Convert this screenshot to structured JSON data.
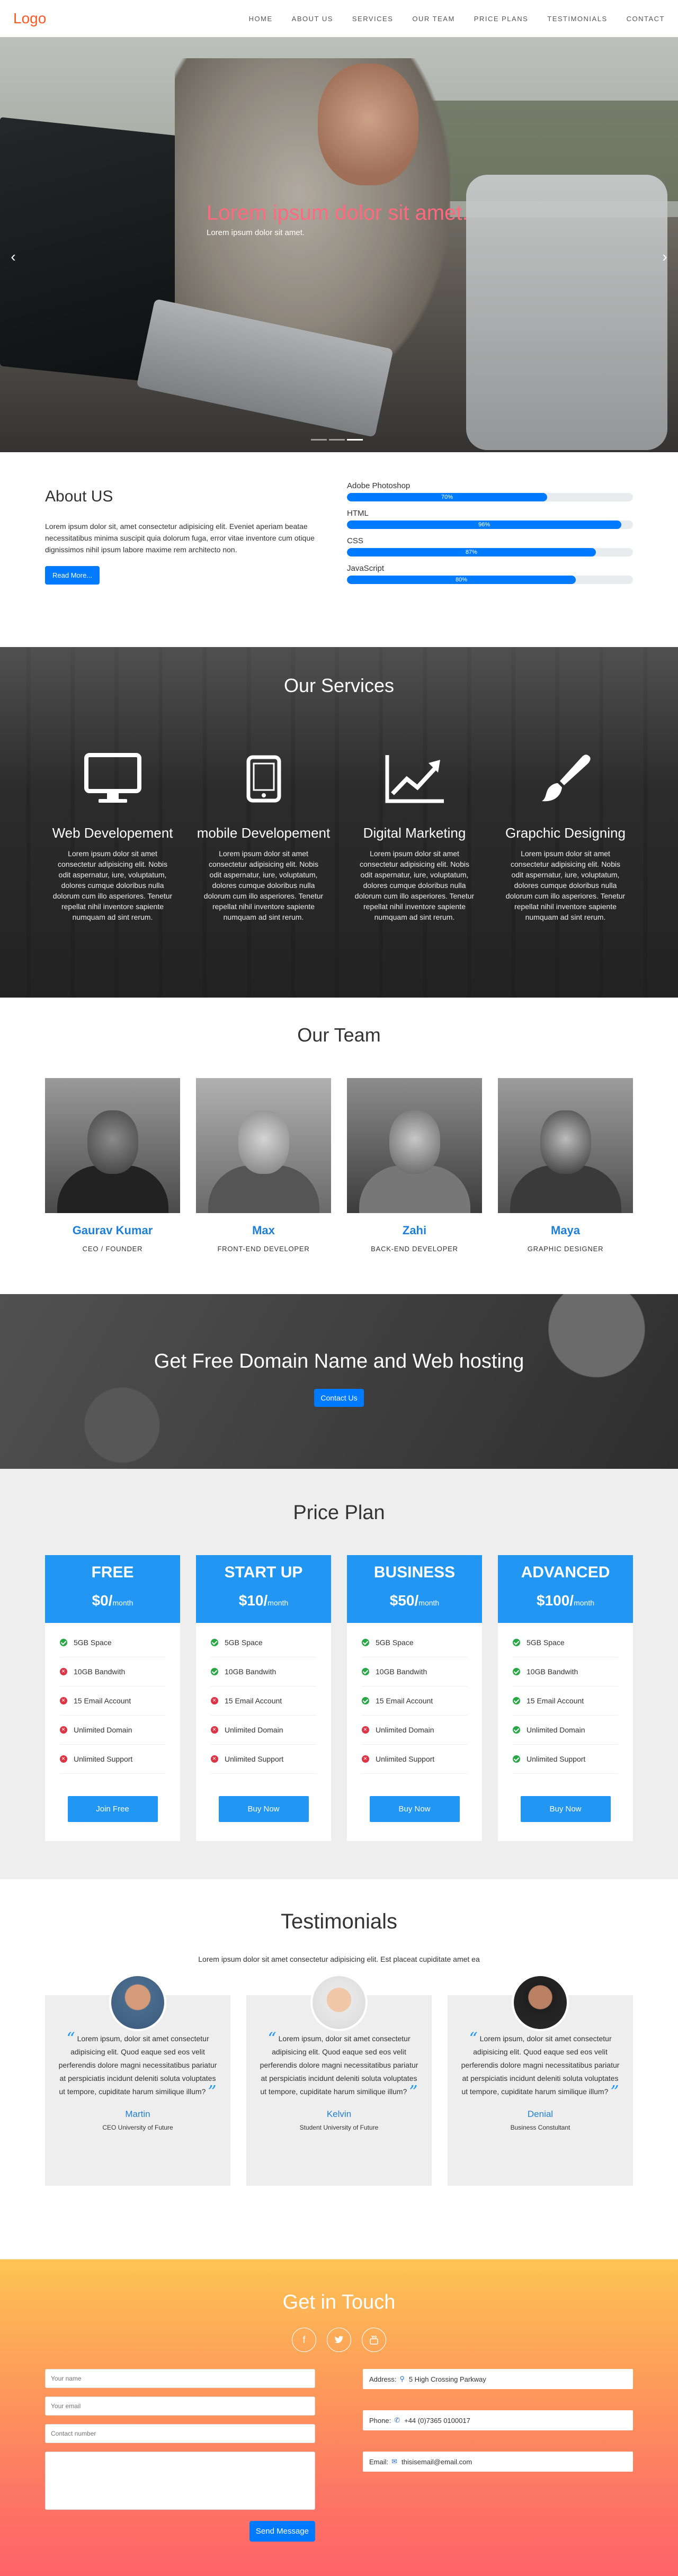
{
  "nav": {
    "logo": "Logo",
    "items": [
      "HOME",
      "ABOUT US",
      "SERVICES",
      "OUR TEAM",
      "PRICE PLANS",
      "TESTIMONIALS",
      "CONTACT"
    ]
  },
  "hero": {
    "title": "Lorem ipsum dolor sit amet.",
    "subtitle": "Lorem ipsum dolor sit amet.",
    "prev_icon": "chevron-left-icon",
    "next_icon": "chevron-right-icon",
    "slides": 3,
    "active_slide": 3
  },
  "about": {
    "title": "About US",
    "text": "Lorem ipsum dolor sit, amet consectetur adipisicing elit. Eveniet aperiam beatae necessitatibus minima suscipit quia dolorum fuga, error vitae inventore cum otique dignissimos nihil ipsum labore maxime rem architecto non.",
    "button": "Read More...",
    "skills": [
      {
        "name": "Adobe Photoshop",
        "label": "70%",
        "percent": 70
      },
      {
        "name": "HTML",
        "label": "96%",
        "percent": 96
      },
      {
        "name": "CSS",
        "label": "87%",
        "percent": 87
      },
      {
        "name": "JavaScript",
        "label": "80%",
        "percent": 80
      }
    ]
  },
  "services": {
    "title": "Our Services",
    "items": [
      {
        "icon": "monitor-icon",
        "title": "Web Developement",
        "text": "Lorem ipsum dolor sit amet consectetur adipisicing elit. Nobis odit aspernatur, iure, voluptatum, dolores cumque doloribus nulla dolorum cum illo asperiores. Tenetur repellat nihil inventore sapiente numquam ad sint rerum."
      },
      {
        "icon": "tablet-icon",
        "title": "mobile Developement",
        "text": "Lorem ipsum dolor sit amet consectetur adipisicing elit. Nobis odit aspernatur, iure, voluptatum, dolores cumque doloribus nulla dolorum cum illo asperiores. Tenetur repellat nihil inventore sapiente numquam ad sint rerum."
      },
      {
        "icon": "chart-line-icon",
        "title": "Digital Marketing",
        "text": "Lorem ipsum dolor sit amet consectetur adipisicing elit. Nobis odit aspernatur, iure, voluptatum, dolores cumque doloribus nulla dolorum cum illo asperiores. Tenetur repellat nihil inventore sapiente numquam ad sint rerum."
      },
      {
        "icon": "paint-brush-icon",
        "title": "Grapchic Designing",
        "text": "Lorem ipsum dolor sit amet consectetur adipisicing elit. Nobis odit aspernatur, iure, voluptatum, dolores cumque doloribus nulla dolorum cum illo asperiores. Tenetur repellat nihil inventore sapiente numquam ad sint rerum."
      }
    ]
  },
  "team": {
    "title": "Our Team",
    "members": [
      {
        "name": "Gaurav Kumar",
        "role": "CEO / FOUNDER"
      },
      {
        "name": "Max",
        "role": "FRONT-END DEVELOPER"
      },
      {
        "name": "Zahi",
        "role": "BACK-END DEVELOPER"
      },
      {
        "name": "Maya",
        "role": "GRAPHIC DESIGNER"
      }
    ]
  },
  "domain": {
    "title": "Get Free Domain Name and Web hosting",
    "button": "Contact Us"
  },
  "pricing": {
    "title": "Price Plan",
    "plans": [
      {
        "name": "FREE",
        "price": "$0/",
        "period": "month",
        "button": "Join Free",
        "features": [
          {
            "text": "5GB Space",
            "ok": true
          },
          {
            "text": "10GB Bandwith",
            "ok": false
          },
          {
            "text": "15 Email Account",
            "ok": false
          },
          {
            "text": "Unlimited Domain",
            "ok": false
          },
          {
            "text": "Unlimited Support",
            "ok": false
          }
        ]
      },
      {
        "name": "START UP",
        "price": "$10/",
        "period": "month",
        "button": "Buy Now",
        "features": [
          {
            "text": "5GB Space",
            "ok": true
          },
          {
            "text": "10GB Bandwith",
            "ok": true
          },
          {
            "text": "15 Email Account",
            "ok": false
          },
          {
            "text": "Unlimited Domain",
            "ok": false
          },
          {
            "text": "Unlimited Support",
            "ok": false
          }
        ]
      },
      {
        "name": "BUSINESS",
        "price": "$50/",
        "period": "month",
        "button": "Buy Now",
        "features": [
          {
            "text": "5GB Space",
            "ok": true
          },
          {
            "text": "10GB Bandwith",
            "ok": true
          },
          {
            "text": "15 Email Account",
            "ok": true
          },
          {
            "text": "Unlimited Domain",
            "ok": false
          },
          {
            "text": "Unlimited Support",
            "ok": false
          }
        ]
      },
      {
        "name": "ADVANCED",
        "price": "$100/",
        "period": "month",
        "button": "Buy Now",
        "features": [
          {
            "text": "5GB Space",
            "ok": true
          },
          {
            "text": "10GB Bandwith",
            "ok": true
          },
          {
            "text": "15 Email Account",
            "ok": true
          },
          {
            "text": "Unlimited Domain",
            "ok": true
          },
          {
            "text": "Unlimited Support",
            "ok": true
          }
        ]
      }
    ]
  },
  "testimonials": {
    "title": "Testimonials",
    "intro": "Lorem ipsum dolor sit amet consectetur adipisicing elit. Est placeat cupiditate amet ea",
    "items": [
      {
        "quote": "Lorem ipsum, dolor sit amet consectetur adipisicing elit. Quod eaque sed eos velit perferendis dolore magni necessitatibus pariatur at perspiciatis incidunt deleniti soluta voluptates ut tempore, cupiditate harum similique illum?",
        "name": "Martin",
        "position": "CEO University of Future"
      },
      {
        "quote": "Lorem ipsum, dolor sit amet consectetur adipisicing elit. Quod eaque sed eos velit perferendis dolore magni necessitatibus pariatur at perspiciatis incidunt deleniti soluta voluptates ut tempore, cupiditate harum similique illum?",
        "name": "Kelvin",
        "position": "Student University of Future"
      },
      {
        "quote": "Lorem ipsum, dolor sit amet consectetur adipisicing elit. Quod eaque sed eos velit perferendis dolore magni necessitatibus pariatur at perspiciatis incidunt deleniti soluta voluptates ut tempore, cupiditate harum similique illum?",
        "name": "Denial",
        "position": "Business Constultant"
      }
    ]
  },
  "contact": {
    "title": "Get in Touch",
    "socials": [
      "facebook-icon",
      "twitter-icon",
      "youtube-icon"
    ],
    "form": {
      "name_placeholder": "Your name",
      "email_placeholder": "Your email",
      "number_placeholder": "Contact number",
      "message_placeholder": "",
      "send": "Send Message"
    },
    "info": {
      "address_label": "Address:",
      "address": "5 High Crossing Parkway",
      "phone_label": "Phone:",
      "phone": "+44 (0)7365 0100017",
      "email_label": "Email:",
      "email": "thisisemail@email.com"
    }
  },
  "colors": {
    "brand": "#ff5722",
    "accent": "#007bff",
    "plan_blue": "#2196f3",
    "hero_title": "#ff6b7e"
  }
}
